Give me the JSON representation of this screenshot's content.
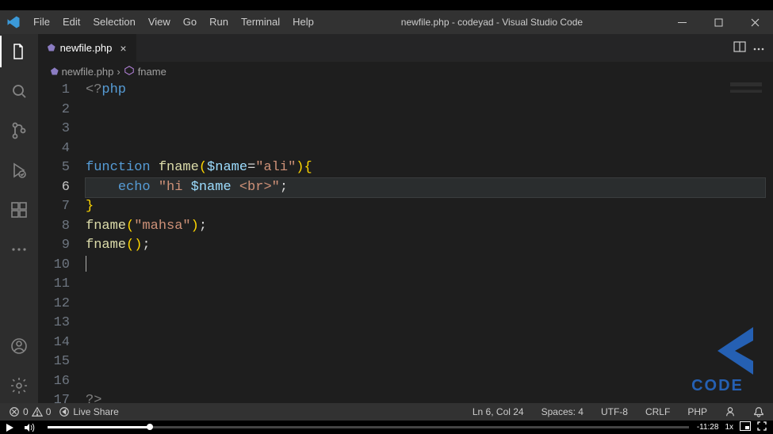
{
  "title_bar": {
    "menu": [
      "File",
      "Edit",
      "Selection",
      "View",
      "Go",
      "Run",
      "Terminal",
      "Help"
    ],
    "title": "newfile.php - codeyad - Visual Studio Code"
  },
  "tabs": {
    "active": {
      "icon": "php",
      "label": "newfile.php"
    }
  },
  "breadcrumb": {
    "file": "newfile.php",
    "symbol": "fname"
  },
  "editor": {
    "active_line": 6,
    "line_count": 17,
    "lines": [
      [
        {
          "c": "tag",
          "t": "<?"
        },
        {
          "c": "key",
          "t": "php"
        }
      ],
      [],
      [],
      [],
      [
        {
          "c": "key",
          "t": "function"
        },
        {
          "c": "white",
          "t": " "
        },
        {
          "c": "func",
          "t": "fname"
        },
        {
          "c": "brace",
          "t": "("
        },
        {
          "c": "var",
          "t": "$name"
        },
        {
          "c": "op",
          "t": "="
        },
        {
          "c": "str",
          "t": "\"ali\""
        },
        {
          "c": "brace",
          "t": ")"
        },
        {
          "c": "brace",
          "t": "{"
        }
      ],
      [
        {
          "c": "white",
          "t": "    "
        },
        {
          "c": "key",
          "t": "echo"
        },
        {
          "c": "white",
          "t": " "
        },
        {
          "c": "str",
          "t": "\"hi "
        },
        {
          "c": "var",
          "t": "$name"
        },
        {
          "c": "str",
          "t": " <br>\""
        },
        {
          "c": "op",
          "t": ";"
        }
      ],
      [
        {
          "c": "brace",
          "t": "}"
        }
      ],
      [
        {
          "c": "func",
          "t": "fname"
        },
        {
          "c": "brace",
          "t": "("
        },
        {
          "c": "str",
          "t": "\"mahsa\""
        },
        {
          "c": "brace",
          "t": ")"
        },
        {
          "c": "op",
          "t": ";"
        }
      ],
      [
        {
          "c": "func",
          "t": "fname"
        },
        {
          "c": "brace",
          "t": "("
        },
        {
          "c": "brace",
          "t": ")"
        },
        {
          "c": "op",
          "t": ";"
        }
      ],
      []
    ],
    "last_line_tokens": [
      {
        "c": "tag",
        "t": "?>"
      }
    ]
  },
  "status_bar": {
    "errors": "0",
    "warnings": "0",
    "live_share": "Live Share",
    "cursor_pos": "Ln 6, Col 24",
    "indent": "Spaces: 4",
    "encoding": "UTF-8",
    "eol": "CRLF",
    "language": "PHP"
  },
  "player": {
    "time_remaining": "-11:28",
    "speed": "1x",
    "progress_pct": 16
  },
  "watermark": {
    "text": "CODE"
  }
}
